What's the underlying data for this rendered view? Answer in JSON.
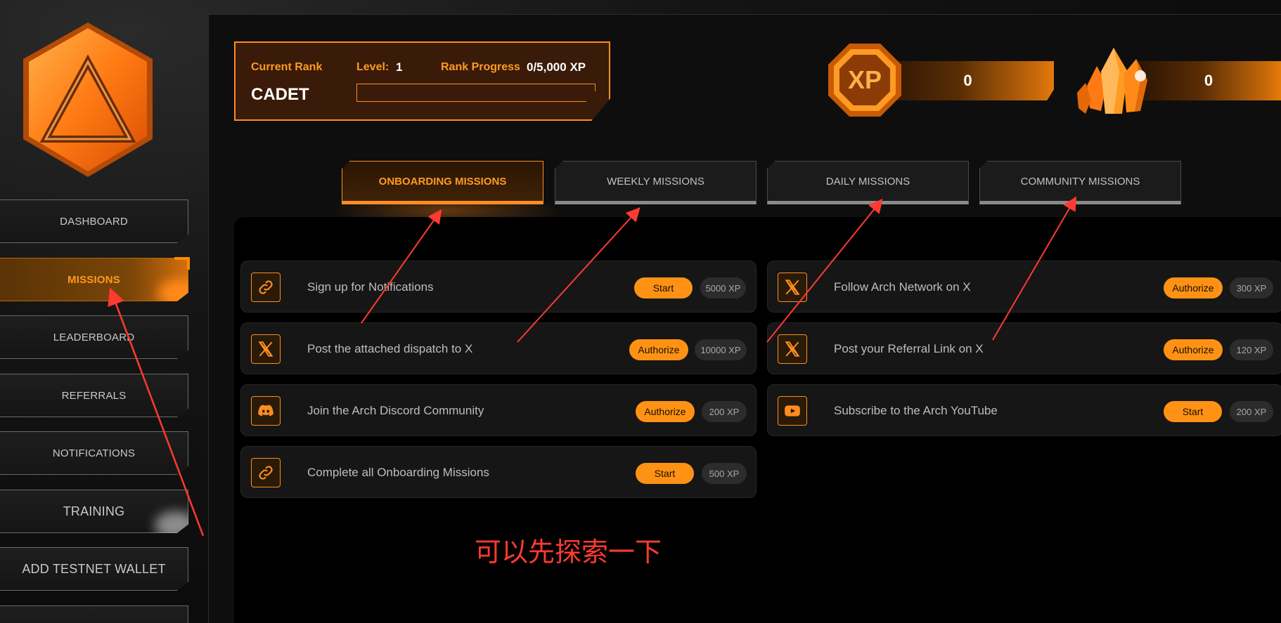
{
  "sidebar": {
    "items": [
      {
        "label": "DASHBOARD"
      },
      {
        "label": "MISSIONS"
      },
      {
        "label": "LEADERBOARD"
      },
      {
        "label": "REFERRALS"
      },
      {
        "label": "NOTIFICATIONS"
      },
      {
        "label": "TRAINING"
      },
      {
        "label": "ADD TESTNET WALLET"
      }
    ],
    "active": "MISSIONS"
  },
  "rank": {
    "current_rank_label": "Current Rank",
    "rank_name": "CADET",
    "level_label": "Level:",
    "level_value": "1",
    "progress_label": "Rank Progress",
    "progress_value": "0/5,000 XP",
    "progress_fraction": 0
  },
  "stats": {
    "xp_badge": "XP",
    "xp_value": "0",
    "crystal_value": "0"
  },
  "tabs": [
    {
      "label": "ONBOARDING MISSIONS",
      "active": true
    },
    {
      "label": "WEEKLY MISSIONS",
      "active": false
    },
    {
      "label": "DAILY MISSIONS",
      "active": false
    },
    {
      "label": "COMMUNITY MISSIONS",
      "active": false
    }
  ],
  "missions_left": [
    {
      "title": "Sign up for Notifications",
      "action": "Start",
      "xp": "5000 XP",
      "icon": "link-icon"
    },
    {
      "title": "Post the attached dispatch to X",
      "action": "Authorize",
      "xp": "10000 XP",
      "icon": "x-logo-icon"
    },
    {
      "title": "Join the Arch Discord Community",
      "action": "Authorize",
      "xp": "200 XP",
      "icon": "discord-icon"
    },
    {
      "title": "Complete all Onboarding Missions",
      "action": "Start",
      "xp": "500 XP",
      "icon": "link-icon"
    }
  ],
  "missions_right": [
    {
      "title": "Follow Arch Network on X",
      "action": "Authorize",
      "xp": "300 XP",
      "icon": "x-logo-icon"
    },
    {
      "title": "Post your Referral Link on X",
      "action": "Authorize",
      "xp": "120 XP",
      "icon": "x-logo-icon"
    },
    {
      "title": "Subscribe to the Arch YouTube",
      "action": "Start",
      "xp": "200 XP",
      "icon": "youtube-icon"
    }
  ],
  "annotation": {
    "note": "可以先探索一下",
    "color": "#ff3a30"
  },
  "colors": {
    "accent": "#ff8d1f",
    "background": "#0e0e0e"
  }
}
